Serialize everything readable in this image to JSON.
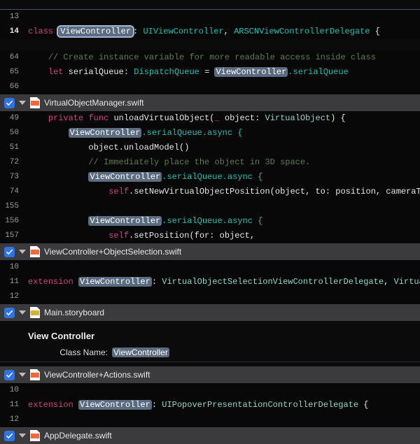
{
  "tokens": {
    "class": "class",
    "private": "private",
    "func": "func",
    "let": "let",
    "extension": "extension",
    "self": "self"
  },
  "hl": "ViewController",
  "block0": {
    "rows": [
      13,
      14
    ],
    "decl": {
      "colon": ": ",
      "t1": "UIViewController",
      "sep": ", ",
      "t2": "ARSCNViewControllerDelegate",
      "brace": " {"
    }
  },
  "block1": {
    "rows": [
      64,
      65,
      66
    ],
    "comment": "// Create instance variable for more readable access inside class",
    "varname": " serialQueue",
    "colon": ": ",
    "type": "DispatchQueue",
    "eq": " = ",
    "tail": ".serialQueue"
  },
  "file_vom": "VirtualObjectManager.swift",
  "block2": {
    "rows": [
      49,
      50,
      51,
      72,
      73,
      74,
      155,
      156,
      157
    ],
    "l49a": " unloadVirtualObject",
    "l49b": "(",
    "l49c": "_",
    "l49d": " object: ",
    "l49e": "VirtualObject",
    "l49f": ") {",
    "l50": ".serialQueue.async {",
    "l51": "object.unloadModel()",
    "l72": "// Immediately place the object in 3D space.",
    "l73": ".serialQueue.async {",
    "l74": ".setNewVirtualObjectPosition(object, to: position, cameraTrans",
    "l156": ".serialQueue.async {",
    "l157": ".setPosition(for: object,"
  },
  "file_sel": "ViewController+ObjectSelection.swift",
  "block3": {
    "rows": [
      10,
      11,
      12
    ],
    "t1": ": ",
    "d1": "VirtualObjectSelectionViewControllerDelegate",
    "sep": ", ",
    "d2": "VirtualOb"
  },
  "file_sb": "Main.storyboard",
  "sb": {
    "header": "View Controller",
    "label": "Class Name:"
  },
  "file_act": "ViewController+Actions.swift",
  "block4": {
    "rows": [
      10,
      11,
      12
    ],
    "t1": ": ",
    "d1": "UIPopoverPresentationControllerDelegate",
    "brace": " {"
  },
  "file_app": "AppDelegate.swift"
}
